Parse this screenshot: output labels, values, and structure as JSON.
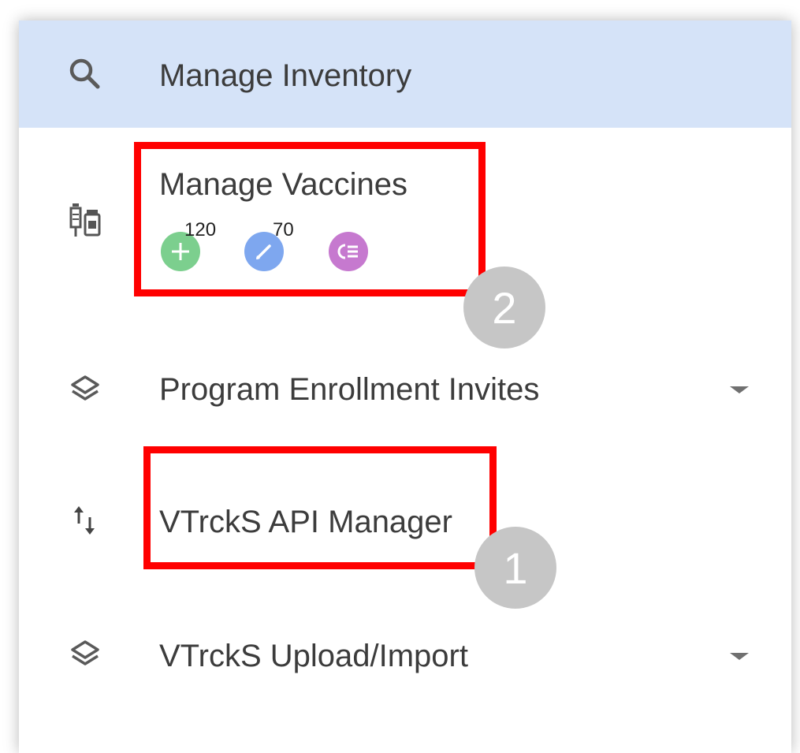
{
  "menu": {
    "items": [
      {
        "label": "Manage Inventory",
        "icon": "search-icon",
        "active": true
      },
      {
        "label": "Manage Vaccines",
        "icon": "vaccine-vials-icon"
      },
      {
        "label": "Program Enrollment Invites",
        "icon": "layers-icon",
        "has_dropdown": true
      },
      {
        "label": "VTrckS API Manager",
        "icon": "transfer-arrows-icon"
      },
      {
        "label": "VTrckS Upload/Import",
        "icon": "layers-icon",
        "has_dropdown": true
      }
    ],
    "vaccine_actions": [
      {
        "name": "add",
        "icon": "plus-icon",
        "count": "120",
        "color": "#7ccf8e"
      },
      {
        "name": "edit",
        "icon": "pencil-icon",
        "count": "70",
        "color": "#7ea7ef"
      },
      {
        "name": "list",
        "icon": "list-icon",
        "color": "#c679cf"
      }
    ]
  },
  "annotations": {
    "callout_1": "1",
    "callout_2": "2",
    "highlight_color": "#ff0000",
    "callout_color": "#c6c6c6"
  },
  "colors": {
    "active_row": "#d5e3f8",
    "text": "#3c3c3c"
  }
}
